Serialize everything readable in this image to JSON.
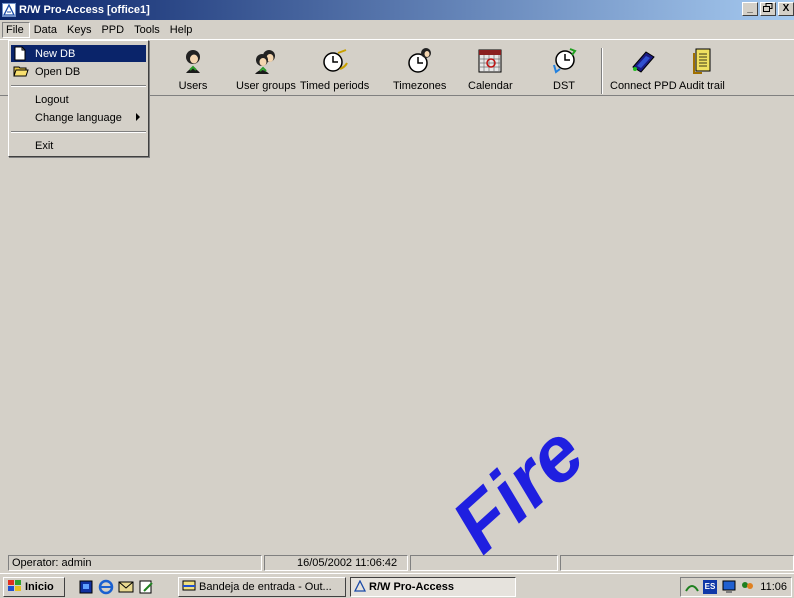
{
  "window": {
    "title": "R/W Pro-Access [office1]",
    "buttons": [
      "_",
      "̅",
      "X"
    ]
  },
  "menubar": [
    "File",
    "Data",
    "Keys",
    "PPD",
    "Tools",
    "Help"
  ],
  "file_menu": {
    "items": [
      {
        "label": "New DB",
        "icon": "new-document-icon",
        "highlighted": true
      },
      {
        "label": "Open DB",
        "icon": "open-folder-icon"
      },
      {
        "label": "Logout"
      },
      {
        "label": "Change language",
        "submenu": true
      },
      {
        "label": "Exit"
      }
    ]
  },
  "toolbar": [
    {
      "label": "Users",
      "icon": "user-icon"
    },
    {
      "label": "User groups",
      "icon": "user-group-icon"
    },
    {
      "label": "Timed periods",
      "icon": "timed-periods-icon"
    },
    {
      "label": "Timezones",
      "icon": "timezone-icon"
    },
    {
      "label": "Calendar",
      "icon": "calendar-icon"
    },
    {
      "label": "DST",
      "icon": "dst-clock-icon"
    },
    {
      "label": "Connect PPD",
      "icon": "connect-ppd-icon"
    },
    {
      "label": "Audit trail",
      "icon": "audit-trail-icon"
    }
  ],
  "statusbar": {
    "operator": "Operator: admin",
    "datetime": "16/05/2002 11:06:42"
  },
  "taskbar": {
    "start_label": "Inicio",
    "tasks": [
      "Bandeja de entrada - Out...",
      "R/W Pro-Access"
    ],
    "language_badge": "ES",
    "clock": "11:06"
  },
  "watermark": "Fire",
  "colors": {
    "title_bar": "#0a246a",
    "menu_highlight": "#0a246a",
    "face": "#d4d0c8",
    "watermark": "#1f1fe0"
  }
}
